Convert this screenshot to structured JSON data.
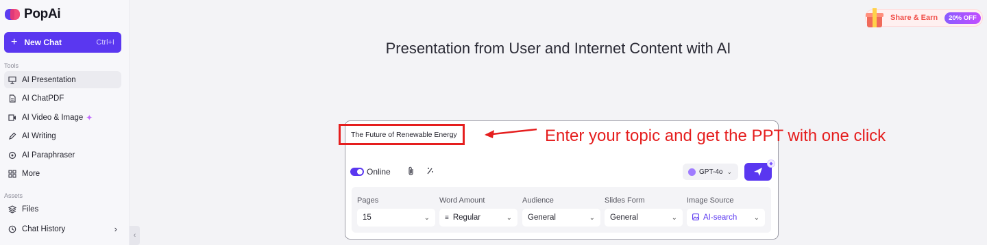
{
  "brand": {
    "name": "PopAi"
  },
  "sidebar": {
    "new_chat_label": "New Chat",
    "new_chat_shortcut": "Ctrl+I",
    "tools_label": "Tools",
    "tools": [
      {
        "label": "AI Presentation",
        "icon": "presentation-icon"
      },
      {
        "label": "AI ChatPDF",
        "icon": "pdf-icon"
      },
      {
        "label": "AI Video & Image",
        "icon": "video-image-icon"
      },
      {
        "label": "AI Writing",
        "icon": "pen-icon"
      },
      {
        "label": "AI Paraphraser",
        "icon": "paraphrase-icon"
      },
      {
        "label": "More",
        "icon": "grid-icon"
      }
    ],
    "assets_label": "Assets",
    "assets": [
      {
        "label": "Files",
        "icon": "layers-icon"
      },
      {
        "label": "Chat History",
        "icon": "history-icon"
      }
    ]
  },
  "header": {
    "share_label": "Share & Earn",
    "share_badge": "20% OFF"
  },
  "main": {
    "title": "Presentation from User and Internet Content with AI",
    "topic_value": "The Future of Renewable Energy",
    "annotation": "Enter your topic and get the PPT with one click",
    "online_label": "Online",
    "model_label": "GPT-4o",
    "options": [
      {
        "label": "Pages",
        "value": "15"
      },
      {
        "label": "Word Amount",
        "value": "Regular"
      },
      {
        "label": "Audience",
        "value": "General"
      },
      {
        "label": "Slides Form",
        "value": "General"
      },
      {
        "label": "Image Source",
        "value": "AI-search"
      }
    ]
  },
  "colors": {
    "accent": "#5a37f0",
    "annotation_red": "#e51e1e",
    "share_red": "#f0504a"
  }
}
